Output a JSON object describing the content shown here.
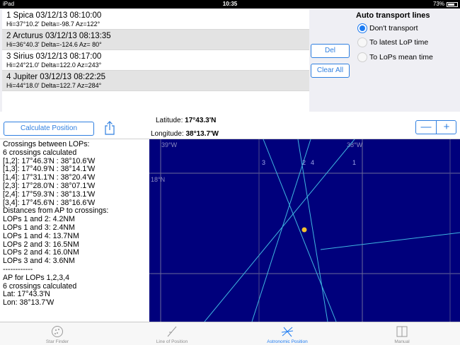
{
  "status_bar": {
    "device": "iPad",
    "time": "10:35",
    "battery": "73%",
    "battery_level": 0.73
  },
  "lops": [
    {
      "title": "1 Spica 03/12/13 08:10:00",
      "details": "Hi=37°10.2'  Delta=-98.7  Az=122°",
      "selected": false
    },
    {
      "title": "2 Arcturus 03/12/13 08:13:35",
      "details": "Hi=36°40.3'  Delta=-124.6  Az= 80°",
      "selected": true
    },
    {
      "title": "3 Sirius 03/12/13 08:17:00",
      "details": "Hi=24°21.0'  Delta=122.0  Az=243°",
      "selected": false
    },
    {
      "title": "4 Jupiter 03/12/13 08:22:25",
      "details": "Hi=44°18.0'  Delta=122.7  Az=284°",
      "selected": true
    }
  ],
  "buttons": {
    "del": "Del",
    "clear_all": "Clear All",
    "calculate": "Calculate Position"
  },
  "transport": {
    "title": "Auto transport lines",
    "options": [
      {
        "label": "Don't  transport",
        "selected": true
      },
      {
        "label": "To latest LoP time",
        "selected": false
      },
      {
        "label": "To LoPs mean time",
        "selected": false
      }
    ]
  },
  "position": {
    "latitude_label": "Latitude:",
    "latitude_value": "17°43.3'N",
    "longitude_label": "Longitude:",
    "longitude_value": "38°13.7'W"
  },
  "zoom": {
    "minus": "—",
    "plus": "+"
  },
  "results_lines": [
    "Crossings between LOPs:",
    "6 crossings calculated",
    "[1,2]: 17°46.3'N : 38°10.6'W",
    "[1,3]: 17°40.9'N : 38°14.1'W",
    "[1,4]: 17°31.1'N : 38°20.4'W",
    "[2,3]: 17°28.0'N : 38°07.1'W",
    "[2,4]: 17°59.3'N : 38°13.1'W",
    "[3,4]: 17°45.6'N : 38°16.6'W",
    "Distances from AP to crossings:",
    "LOPs 1 and 2:  4.2NM",
    "LOPs 1 and 3:  2.4NM",
    "LOPs 1 and 4: 13.7NM",
    "LOPs 2 and 3: 16.5NM",
    "LOPs 2 and 4: 16.0NM",
    "LOPs 3 and 4:  3.6NM",
    "------------",
    "AP for LOPs 1,2,3,4",
    "6 crossings calculated",
    "Lat: 17°43.3'N",
    "Lon: 38°13.7'W"
  ],
  "chart": {
    "grid_labels": {
      "lon_left": "39°W",
      "lon_right": "38°W",
      "lat": "18°N"
    },
    "line_labels": [
      "3",
      "2",
      "4",
      "1"
    ],
    "colors": {
      "background": "#00007c",
      "lop_line": "#3fb6e0",
      "grid": "#6a6a9a",
      "position_dot": "#f2c12e"
    }
  },
  "tabs": [
    {
      "label": "Star Finder",
      "icon": "star-finder-icon",
      "active": false
    },
    {
      "label": "Line of Position",
      "icon": "line-of-position-icon",
      "active": false
    },
    {
      "label": "Astronomic Position",
      "icon": "astronomic-position-icon",
      "active": true
    },
    {
      "label": "Manual",
      "icon": "book-icon",
      "active": false
    }
  ]
}
